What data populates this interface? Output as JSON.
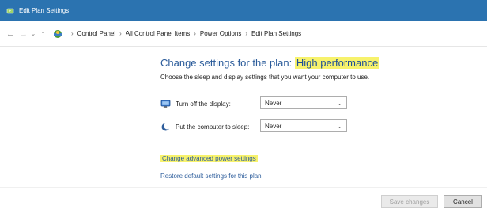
{
  "window": {
    "title": "Edit Plan Settings"
  },
  "address_bar": {
    "breadcrumbs": [
      "Control Panel",
      "All Control Panel Items",
      "Power Options",
      "Edit Plan Settings"
    ]
  },
  "main": {
    "heading_prefix": "Change settings for the plan:",
    "plan_name": "High performance",
    "subheading": "Choose the sleep and display settings that you want your computer to use.",
    "settings": [
      {
        "label": "Turn off the display:",
        "value": "Never",
        "icon": "monitor-icon"
      },
      {
        "label": "Put the computer to sleep:",
        "value": "Never",
        "icon": "moon-icon"
      }
    ],
    "links": {
      "advanced": "Change advanced power settings",
      "restore": "Restore default settings for this plan"
    }
  },
  "footer": {
    "save_label": "Save changes",
    "cancel_label": "Cancel"
  },
  "colors": {
    "titlebar": "#2b73b0",
    "link": "#2a5b9a",
    "highlight": "#f7f26c"
  }
}
